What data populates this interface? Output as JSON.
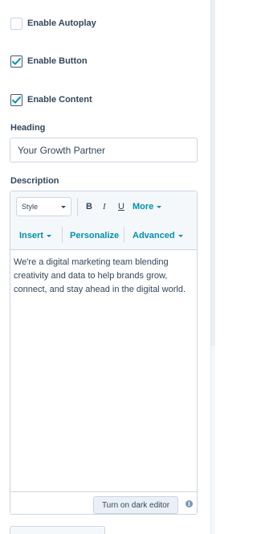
{
  "settings": {
    "autoplay": {
      "label": "Enable Autoplay",
      "checked": false
    },
    "button": {
      "label": "Enable Button",
      "checked": true
    },
    "content": {
      "label": "Enable Content",
      "checked": true
    }
  },
  "heading": {
    "label": "Heading",
    "value": "Your Growth Partner"
  },
  "description": {
    "label": "Description",
    "toolbar": {
      "style_select": "Style",
      "bold": "B",
      "italic": "I",
      "underline": "U",
      "more": "More",
      "insert": "Insert",
      "personalize": "Personalize",
      "advanced": "Advanced"
    },
    "body_text": "We're a digital marketing team blending creativity and data to help brands grow, connect, and stay ahead in the digital world.",
    "dark_editor_button": "Turn on dark editor",
    "info_icon": "i"
  },
  "colors": {
    "text": "#33475b",
    "link": "#0091ae",
    "border": "#cbd6e2",
    "toolbar_bg": "#f5f8fa"
  }
}
